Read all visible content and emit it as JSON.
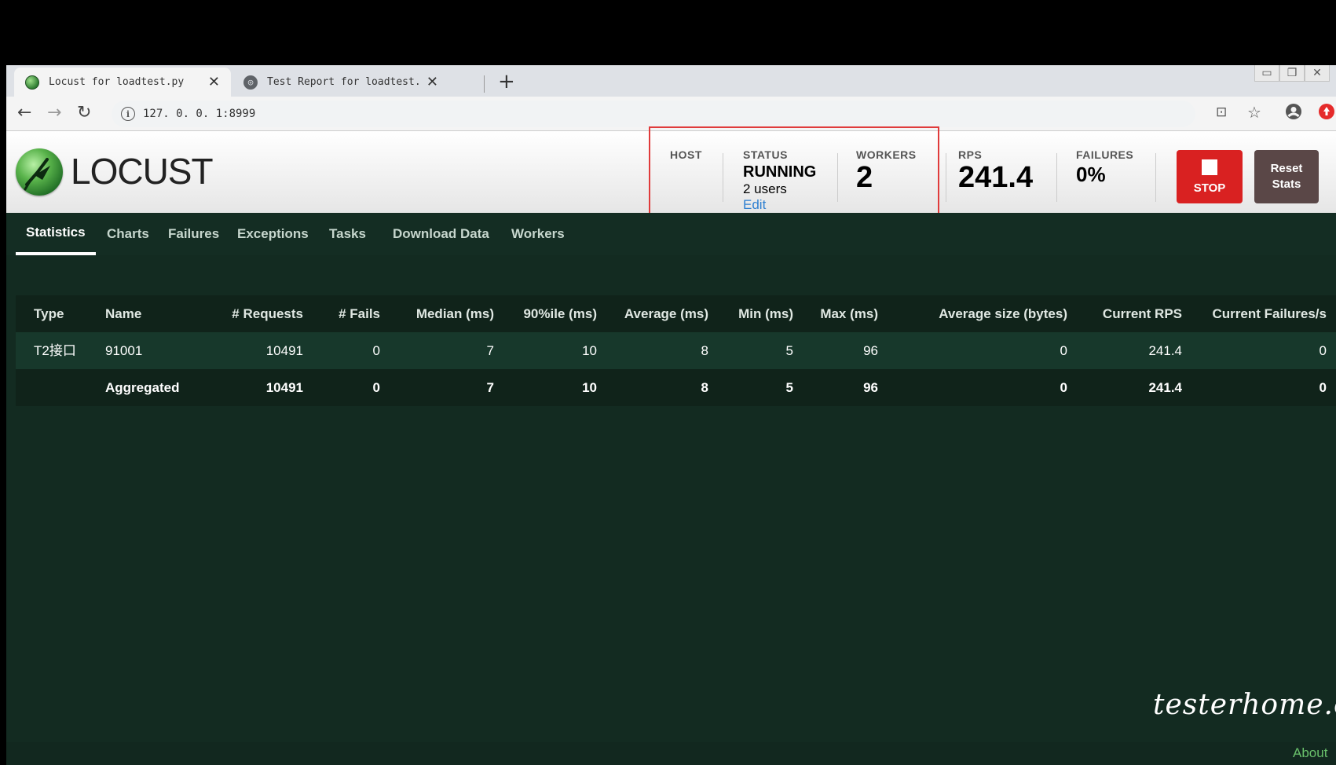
{
  "browser": {
    "tabs": [
      {
        "title": "Locust for loadtest.py",
        "favicon": "locust-favicon",
        "active": true
      },
      {
        "title": "Test Report for loadtest.py",
        "favicon": "globe-icon",
        "active": false
      }
    ],
    "new_tab_label": "+",
    "url": "127. 0. 0. 1:8999"
  },
  "header": {
    "logo_text": "LOCUST",
    "host_label": "HOST",
    "status_label": "STATUS",
    "status_value": "RUNNING",
    "status_users": "2 users",
    "status_edit": "Edit",
    "workers_label": "WORKERS",
    "workers_value": "2",
    "rps_label": "RPS",
    "rps_value": "241.4",
    "failures_label": "FAILURES",
    "failures_value": "0%",
    "stop_label": "STOP",
    "reset_line1": "Reset",
    "reset_line2": "Stats",
    "highlight_color": "#e03b3b"
  },
  "nav": {
    "tabs": [
      "Statistics",
      "Charts",
      "Failures",
      "Exceptions",
      "Tasks",
      "Download Data",
      "Workers"
    ],
    "active": "Statistics"
  },
  "table": {
    "headers": [
      "Type",
      "Name",
      "# Requests",
      "# Fails",
      "Median (ms)",
      "90%ile (ms)",
      "Average (ms)",
      "Min (ms)",
      "Max (ms)",
      "Average size (bytes)",
      "Current RPS",
      "Current Failures/s"
    ],
    "rows": [
      [
        "T2接口",
        "91001",
        "10491",
        "0",
        "7",
        "10",
        "8",
        "5",
        "96",
        "0",
        "241.4",
        "0"
      ]
    ],
    "aggregated": [
      "",
      "Aggregated",
      "10491",
      "0",
      "7",
      "10",
      "8",
      "5",
      "96",
      "0",
      "241.4",
      "0"
    ]
  },
  "footer": {
    "watermark": "testerhome.com",
    "about": "About"
  }
}
